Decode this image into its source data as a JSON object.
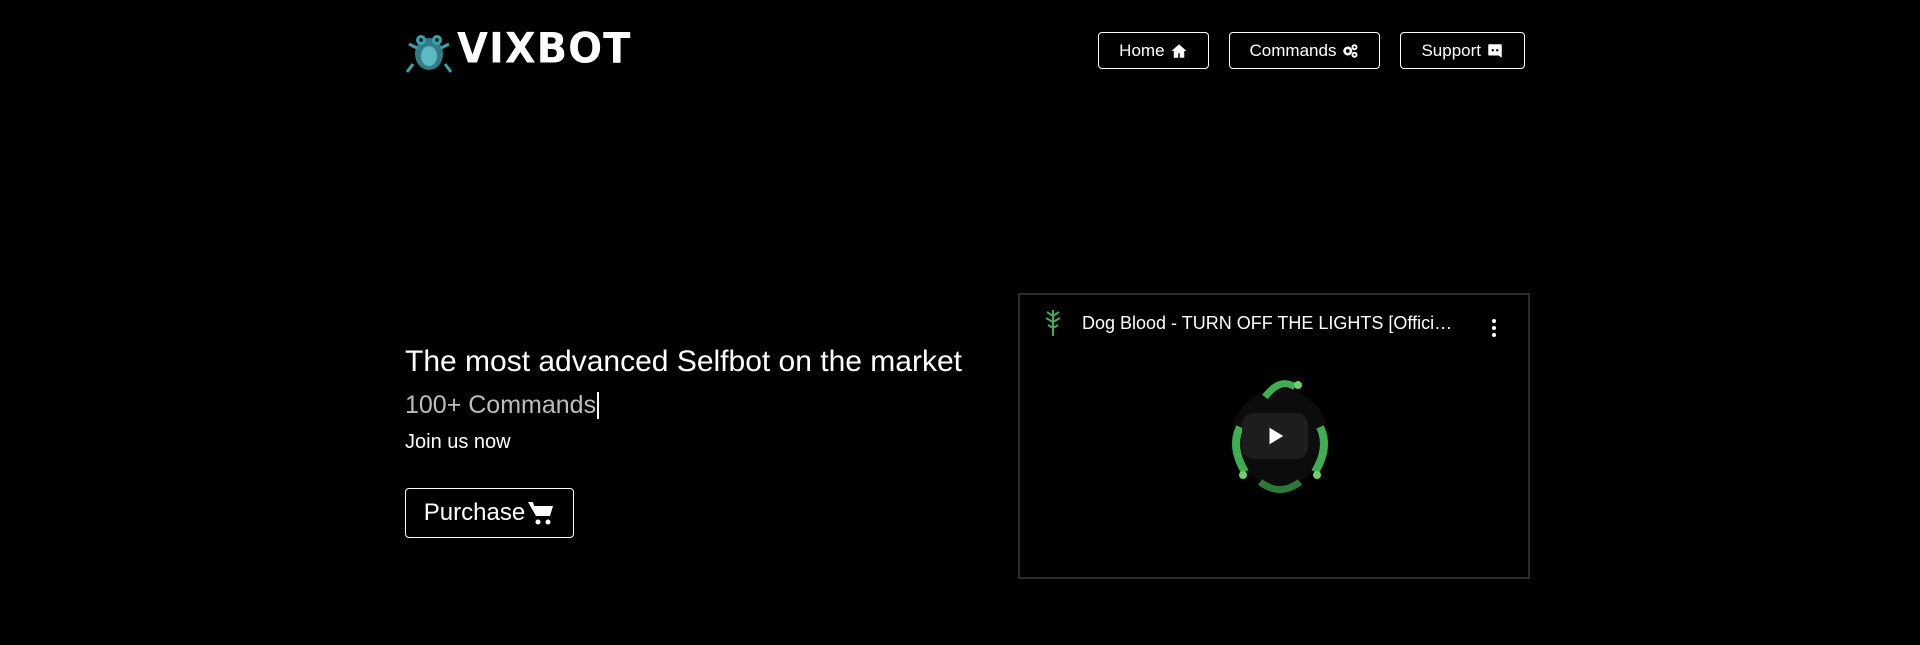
{
  "header": {
    "logo_text": "VIXBOT",
    "nav": [
      {
        "label": "Home",
        "icon": "home-icon"
      },
      {
        "label": "Commands",
        "icon": "gears-icon"
      },
      {
        "label": "Support",
        "icon": "discord-icon"
      }
    ]
  },
  "hero": {
    "title": "The most advanced Selfbot on the market",
    "subtitle": "100+ Commands",
    "join_text": "Join us now",
    "purchase_label": "Purchase"
  },
  "video": {
    "title": "Dog Blood - TURN OFF THE LIGHTS [Official A..."
  },
  "colors": {
    "background": "#000000",
    "text": "#ffffff",
    "subtitle": "#bdbdbd",
    "frog_green": "#3fae52"
  }
}
